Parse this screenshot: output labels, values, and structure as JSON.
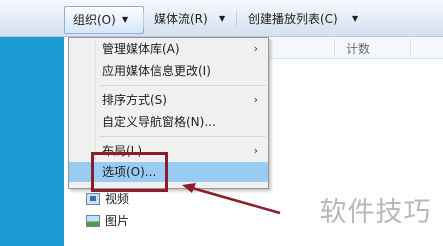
{
  "toolbar": {
    "organize": "组织(O)",
    "media_stream": "媒体流(R)",
    "create_playlist": "创建播放列表(C)"
  },
  "column_header": {
    "count": "计数"
  },
  "menu": {
    "items": [
      {
        "label": "管理媒体库(A)",
        "submenu": true
      },
      {
        "label": "应用媒体信息更改(I)",
        "submenu": false
      },
      {
        "label": "排序方式(S)",
        "submenu": true
      },
      {
        "label": "自定义导航窗格(N)...",
        "submenu": false
      },
      {
        "label": "布局(L)",
        "submenu": true
      },
      {
        "label": "选项(O)...",
        "submenu": false,
        "highlighted": true
      }
    ]
  },
  "nav": {
    "video": "视频",
    "pictures": "图片"
  },
  "watermark": "软件技巧",
  "icons": {
    "dropdown": "chevron-down-icon",
    "submenu": "chevron-right-icon",
    "video": "video-library-icon",
    "pictures": "picture-library-icon"
  },
  "colors": {
    "accent_strip": "#1a9bd6",
    "menu_highlight": "#99ccf2",
    "annotation": "#8b1d2c"
  }
}
